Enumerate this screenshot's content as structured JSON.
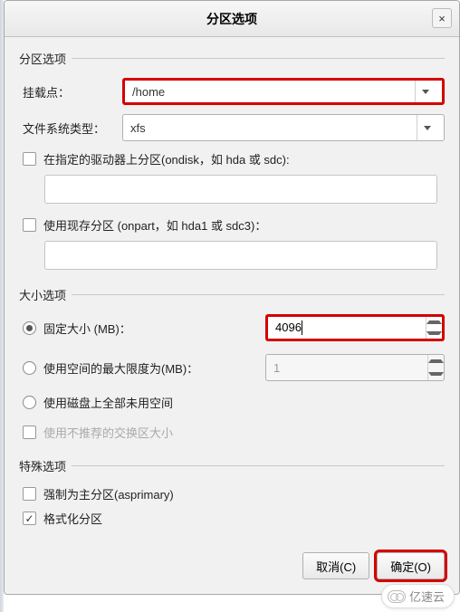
{
  "title": "分区选项",
  "sections": {
    "partition": {
      "title": "分区选项",
      "mount_label": "挂载点：",
      "mount_value": "/home",
      "fs_label": "文件系统类型：",
      "fs_value": "xfs",
      "ondisk_label": "在指定的驱动器上分区(ondisk，如 hda 或 sdc):",
      "onpart_label": "使用现存分区 (onpart，如 hda1 或 sdc3)："
    },
    "size": {
      "title": "大小选项",
      "fixed_label": "固定大小 (MB)：",
      "fixed_value": "4096",
      "max_label": "使用空间的最大限度为(MB)：",
      "max_value": "1",
      "fill_label": "使用磁盘上全部未用空间",
      "swap_label": "使用不推荐的交换区大小"
    },
    "special": {
      "title": "特殊选项",
      "asprimary_label": "强制为主分区(asprimary)",
      "format_label": "格式化分区"
    }
  },
  "buttons": {
    "cancel": "取消(C)",
    "ok": "确定(O)"
  },
  "watermark": "亿速云"
}
